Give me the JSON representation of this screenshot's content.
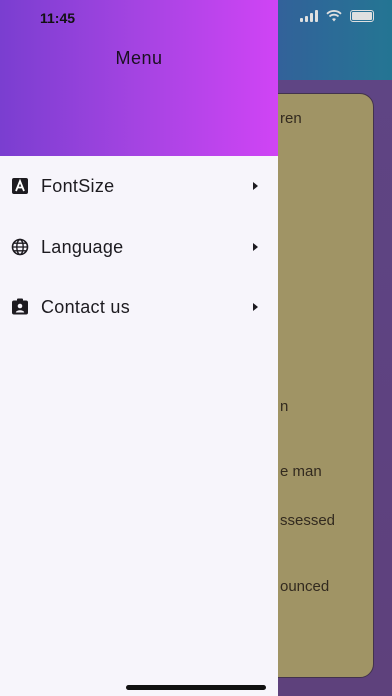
{
  "status": {
    "time": "11:45"
  },
  "drawer": {
    "title": "Menu",
    "items": [
      {
        "label": "FontSize",
        "icon": "font-size-icon"
      },
      {
        "label": "Language",
        "icon": "globe-icon"
      },
      {
        "label": "Contact us",
        "icon": "contact-card-icon"
      }
    ]
  },
  "background": {
    "card_text_fragments": [
      "ren",
      "n",
      "e man",
      "ssessed",
      "ounced"
    ]
  }
}
